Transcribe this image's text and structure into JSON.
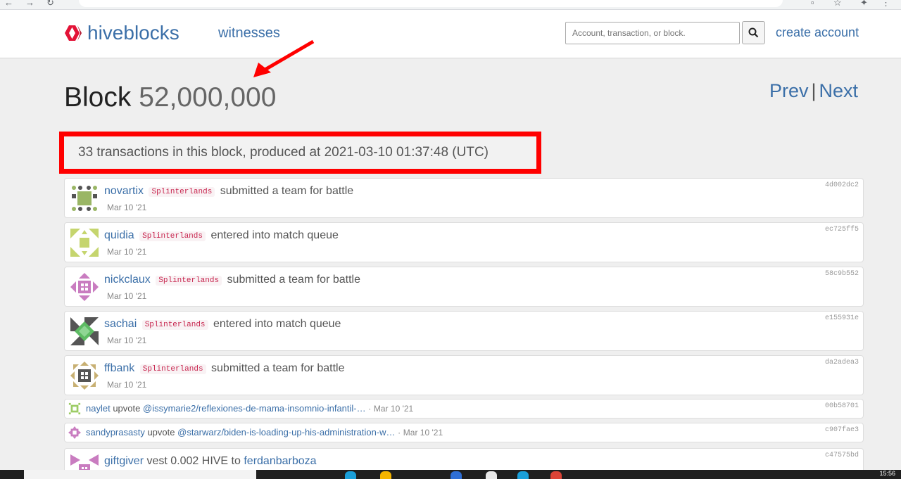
{
  "header": {
    "brand": "hiveblocks",
    "nav_witnesses": "witnesses",
    "search_placeholder": "Account, transaction, or block.",
    "create_account": "create account"
  },
  "page": {
    "block_label": "Block",
    "block_number": "52,000,000",
    "prev": "Prev",
    "separator": "|",
    "next": "Next",
    "summary": "33 transactions in this block, produced at 2021-03-10 01:37:48 (UTC)"
  },
  "transactions": [
    {
      "user": "novartix",
      "tag": "Splinterlands",
      "action": "submitted a team for battle",
      "date": "Mar 10 '21",
      "hash": "4d002dc2"
    },
    {
      "user": "quidia",
      "tag": "Splinterlands",
      "action": "entered into match queue",
      "date": "Mar 10 '21",
      "hash": "ec725ff5"
    },
    {
      "user": "nickclaux",
      "tag": "Splinterlands",
      "action": "submitted a team for battle",
      "date": "Mar 10 '21",
      "hash": "58c9b552"
    },
    {
      "user": "sachai",
      "tag": "Splinterlands",
      "action": "entered into match queue",
      "date": "Mar 10 '21",
      "hash": "e155931e"
    },
    {
      "user": "ffbank",
      "tag": "Splinterlands",
      "action": "submitted a team for battle",
      "date": "Mar 10 '21",
      "hash": "da2adea3"
    }
  ],
  "votes": [
    {
      "user": "naylet",
      "verb": "upvote",
      "link": "@issymarie2/reflexiones-de-mama-insomnio-infantil-…",
      "dot": "·",
      "date": "Mar 10 '21",
      "hash": "00b58701"
    },
    {
      "user": "sandyprasasty",
      "verb": "upvote",
      "link": "@starwarz/biden-is-loading-up-his-administration-w…",
      "dot": "·",
      "date": "Mar 10 '21",
      "hash": "c907fae3"
    }
  ],
  "transfer": {
    "user": "giftgiver",
    "text": "vest 0.002 HIVE to",
    "target": "ferdanbarboza",
    "hash": "c47575bd"
  },
  "taskbar": {
    "clock": "15:56"
  },
  "colors": {
    "link": "#3b6fa8",
    "brand": "#e31337",
    "annotation": "#ff0000",
    "tag": "#c7254e"
  }
}
